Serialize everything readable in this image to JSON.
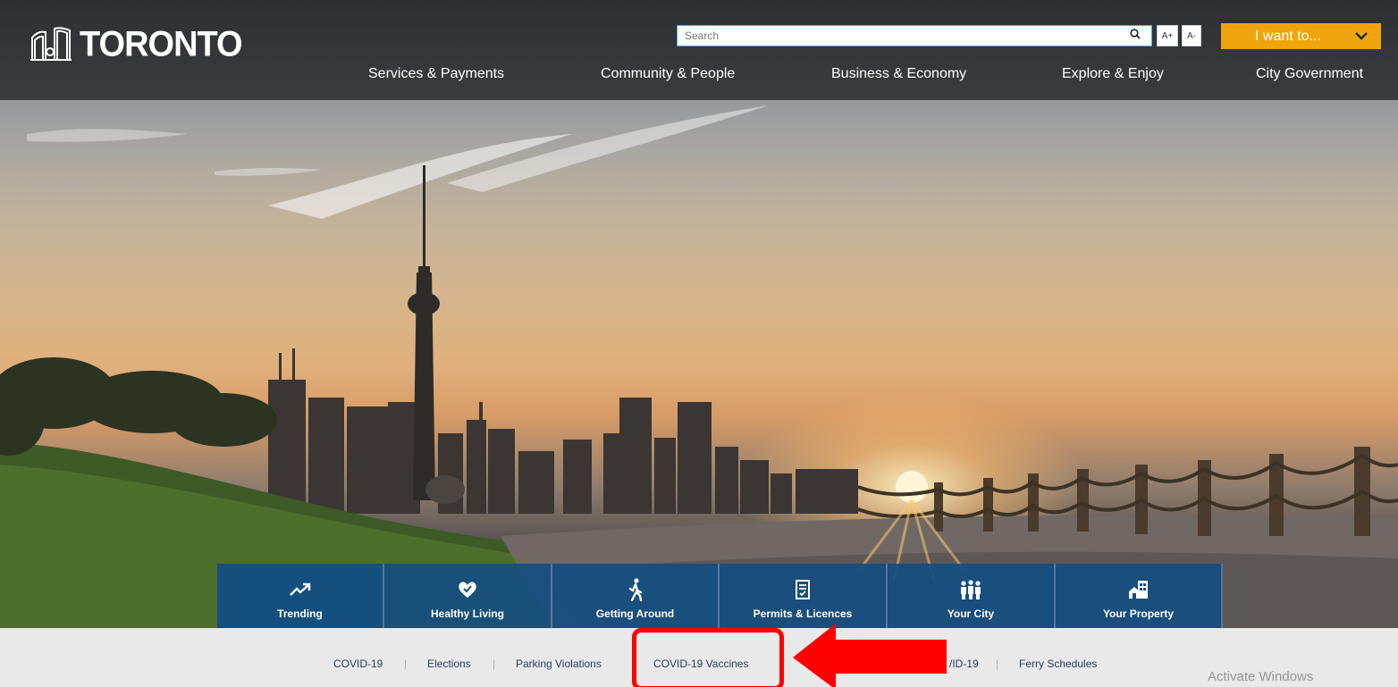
{
  "header": {
    "logo_text": "TORONTO",
    "search": {
      "placeholder": "Search"
    },
    "font_increase_label": "A+",
    "font_decrease_label": "A-",
    "i_want_to_label": "I want to...",
    "nav": [
      {
        "label": "Services & Payments"
      },
      {
        "label": "Community & People"
      },
      {
        "label": "Business & Economy"
      },
      {
        "label": "Explore & Enjoy"
      },
      {
        "label": "City Government"
      }
    ]
  },
  "tabs": [
    {
      "label": "Trending",
      "icon": "trending-icon",
      "active": true
    },
    {
      "label": "Healthy Living",
      "icon": "heart-icon"
    },
    {
      "label": "Getting Around",
      "icon": "walking-icon"
    },
    {
      "label": "Permits & Licences",
      "icon": "document-check-icon"
    },
    {
      "label": "Your City",
      "icon": "people-icon"
    },
    {
      "label": "Your Property",
      "icon": "property-icon"
    }
  ],
  "trending_links": [
    {
      "label": "COVID-19"
    },
    {
      "label": "Elections"
    },
    {
      "label": "Parking Violations"
    },
    {
      "label": "COVID-19 Vaccines"
    },
    {
      "label": "/ID-19"
    },
    {
      "label": "Ferry Schedules"
    }
  ],
  "watermark": "Activate Windows",
  "colors": {
    "header_bg": "#2e3033",
    "accent_orange": "#f0a50f",
    "tab_blue": "#144e80",
    "annotation_red": "#ff0000"
  }
}
